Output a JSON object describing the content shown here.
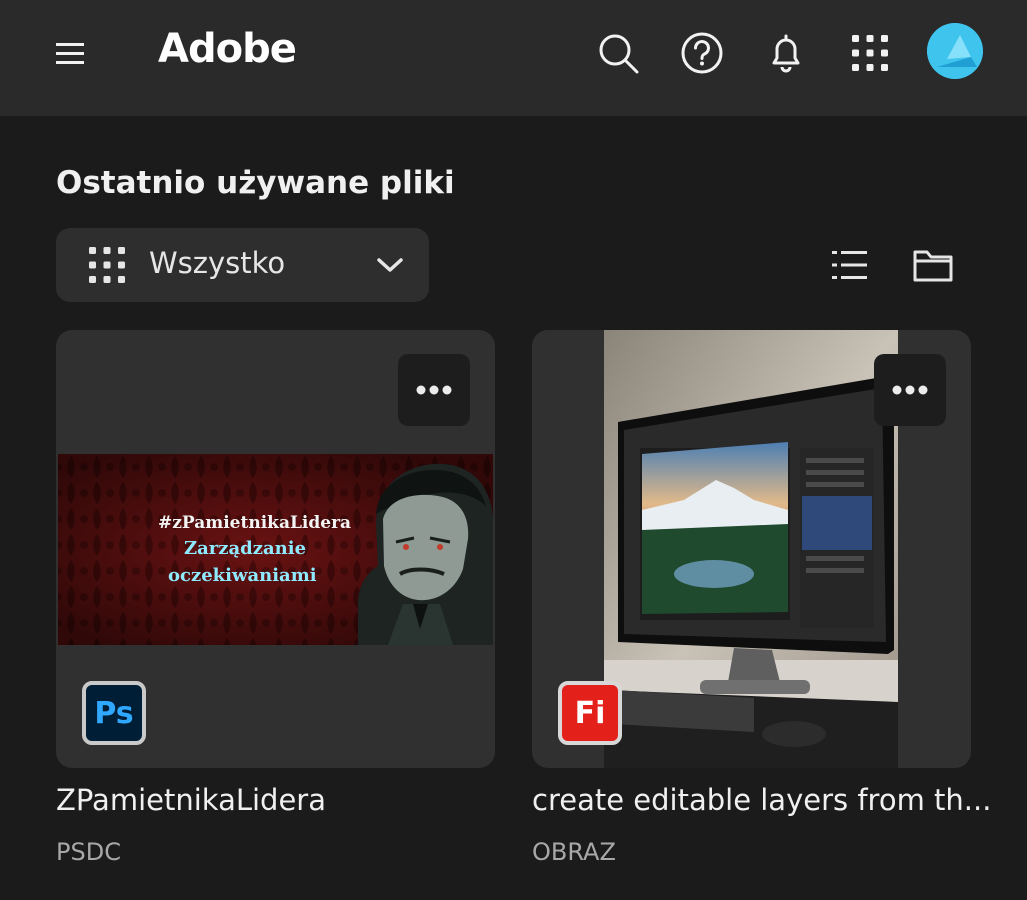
{
  "header": {
    "logo": "Adobe",
    "icons": [
      "menu-icon",
      "search-icon",
      "help-icon",
      "bell-icon",
      "apps-grid-icon",
      "avatar"
    ]
  },
  "main": {
    "section_title": "Ostatnio używane pliki",
    "filter": {
      "selected": "Wszystko"
    },
    "files": [
      {
        "name": "ZPamietnikaLidera",
        "type": "PSDC",
        "app_badge": "Ps",
        "thumb_lines": [
          "#zPamietnikaLidera",
          "Zarządzanie",
          "oczekiwaniami"
        ]
      },
      {
        "name": "create editable layers from th...",
        "type": "OBRAZ",
        "app_badge": "Fi"
      }
    ]
  },
  "colors": {
    "background": "#1b1b1b",
    "topbar": "#2a2a2a",
    "card": "#303030",
    "avatar": "#3fc4ee",
    "ps_blue": "#31a8ff",
    "fi_red": "#e4201b"
  }
}
